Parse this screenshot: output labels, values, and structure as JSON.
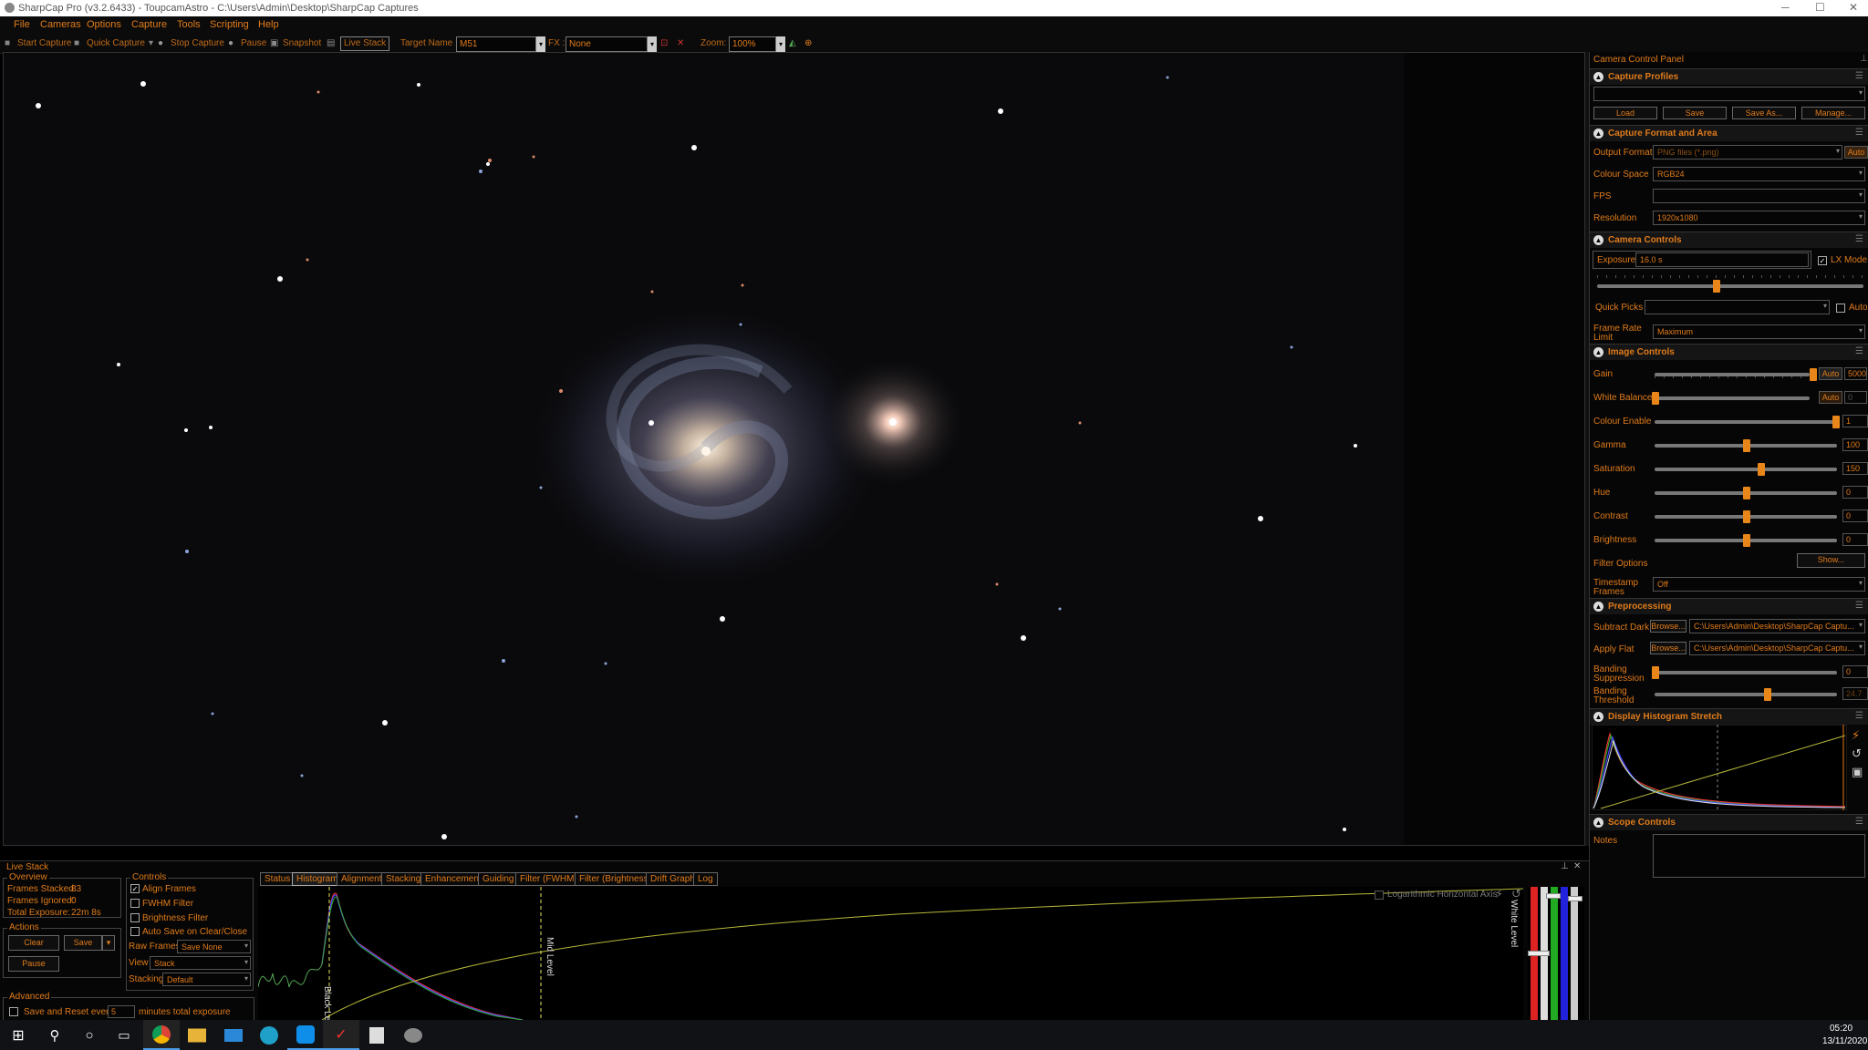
{
  "window": {
    "title": "SharpCap Pro (v3.2.6433) - ToupcamAstro - C:\\Users\\Admin\\Desktop\\SharpCap Captures",
    "min": "─",
    "max": "☐",
    "close": "✕"
  },
  "menu": [
    "File",
    "Cameras",
    "Options",
    "Capture",
    "Tools",
    "Scripting",
    "Help"
  ],
  "toolbar": {
    "start_capture": "Start Capture",
    "quick_capture": "Quick Capture",
    "stop_capture": "Stop Capture",
    "pause": "Pause",
    "snapshot": "Snapshot",
    "live_stack": "Live Stack",
    "target_label": "Target Name :",
    "target_value": "M51",
    "fx_label": "FX :",
    "fx_value": "None",
    "zoom_label": "Zoom:",
    "zoom_value": "100%"
  },
  "panel": {
    "title": "Camera Control Panel",
    "capture_profiles": {
      "title": "Capture Profiles",
      "load": "Load",
      "save": "Save",
      "save_as": "Save As...",
      "manage": "Manage..."
    },
    "format": {
      "title": "Capture Format and Area",
      "output_format_label": "Output Format",
      "output_format": "PNG files (*.png)",
      "auto": "Auto",
      "colour_space_label": "Colour Space",
      "colour_space": "RGB24",
      "fps_label": "FPS",
      "fps": "",
      "resolution_label": "Resolution",
      "resolution": "1920x1080"
    },
    "camera": {
      "title": "Camera Controls",
      "exposure_label": "Exposure",
      "exposure": "16.0 s",
      "lx_mode": "LX Mode",
      "quick_picks_label": "Quick Picks",
      "auto": "Auto",
      "frame_rate_label": "Frame Rate Limit",
      "frame_rate": "Maximum"
    },
    "image": {
      "title": "Image Controls",
      "gain_label": "Gain",
      "gain": "5000",
      "wb_label": "White Balance",
      "wb": "0",
      "auto": "Auto",
      "colour_enable_label": "Colour Enable",
      "colour_enable": "1",
      "gamma_label": "Gamma",
      "gamma": "100",
      "saturation_label": "Saturation",
      "saturation": "150",
      "hue_label": "Hue",
      "hue": "0",
      "contrast_label": "Contrast",
      "contrast": "0",
      "brightness_label": "Brightness",
      "brightness": "0",
      "filter_options_label": "Filter Options",
      "show": "Show...",
      "timestamp_label": "Timestamp Frames",
      "timestamp": "Off"
    },
    "pre": {
      "title": "Preprocessing",
      "dark_label": "Subtract Dark",
      "flat_label": "Apply Flat",
      "browse": "Browse...",
      "path": "C:\\Users\\Admin\\Desktop\\SharpCap Captu...",
      "bs_label": "Banding Suppression",
      "bs": "0",
      "bt_label": "Banding Threshold",
      "bt": "24.7"
    },
    "histo": {
      "title": "Display Histogram Stretch"
    },
    "scope": {
      "title": "Scope Controls",
      "notes_label": "Notes"
    }
  },
  "livestack": {
    "title": "Live Stack",
    "overview": {
      "title": "Overview",
      "frames_stacked_label": "Frames Stacked:",
      "frames_stacked": "83",
      "frames_ignored_label": "Frames Ignored:",
      "frames_ignored": "0",
      "total_exposure_label": "Total Exposure:",
      "total_exposure": "22m 8s"
    },
    "actions": {
      "title": "Actions",
      "clear": "Clear",
      "save": "Save",
      "pause": "Pause"
    },
    "advanced": {
      "title": "Advanced",
      "save_reset": "Save and Reset every",
      "minutes_value": "5",
      "minutes_label": "minutes total exposure"
    },
    "controls": {
      "title": "Controls",
      "align": "Align Frames",
      "fwhm": "FWHM Filter",
      "brightness": "Brightness Filter",
      "autosave": "Auto Save on Clear/Close",
      "raw_label": "Raw Frames",
      "raw": "Save None",
      "view_label": "View",
      "view": "Stack",
      "stacking_label": "Stacking",
      "stacking": "Default"
    },
    "tabs": [
      "Status",
      "Histogram",
      "Alignment",
      "Stacking",
      "Enhancement",
      "Guiding",
      "Filter (FWHM)",
      "Filter (Brightness)",
      "Drift Graph",
      "Log"
    ],
    "log_axis": "Logarithmic Horizontal Axis",
    "black_level": "Black Level",
    "mid_level": "Mid Level",
    "white_level": "White Level"
  },
  "taskbar": {
    "time": "05:20",
    "date": "13/11/2020"
  }
}
